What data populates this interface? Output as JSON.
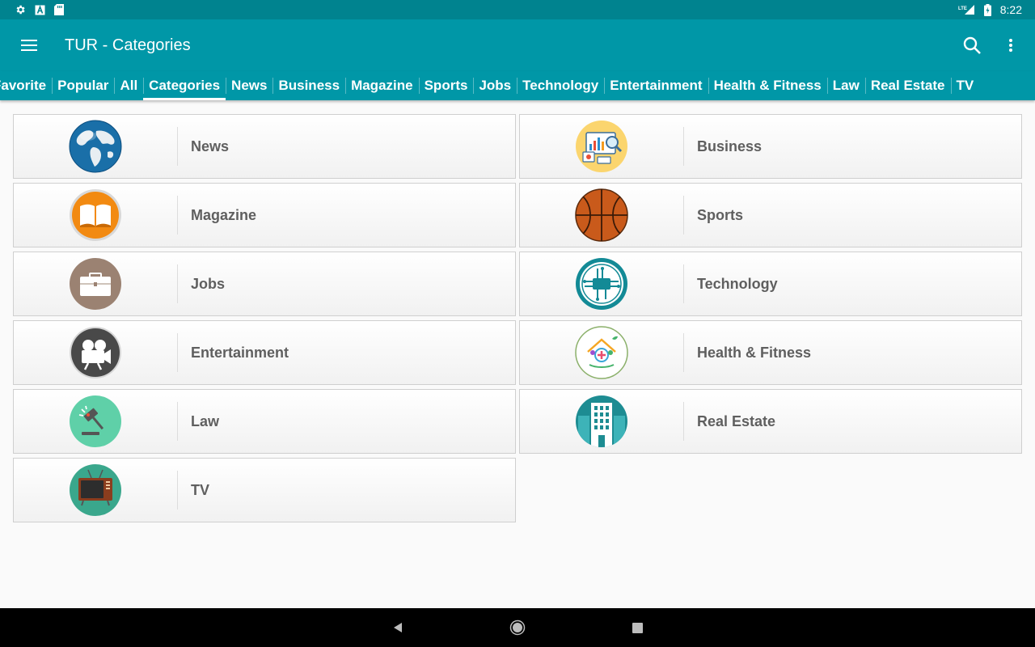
{
  "status_bar": {
    "time": "8:22",
    "network": "LTE"
  },
  "app_bar": {
    "title": "TUR - Categories"
  },
  "tabs": [
    {
      "label": "Favorite"
    },
    {
      "label": "Popular"
    },
    {
      "label": "All"
    },
    {
      "label": "Categories",
      "active": true
    },
    {
      "label": "News"
    },
    {
      "label": "Business"
    },
    {
      "label": "Magazine"
    },
    {
      "label": "Sports"
    },
    {
      "label": "Jobs"
    },
    {
      "label": "Technology"
    },
    {
      "label": "Entertainment"
    },
    {
      "label": "Health & Fitness"
    },
    {
      "label": "Law"
    },
    {
      "label": "Real Estate"
    },
    {
      "label": "TV"
    }
  ],
  "categories": [
    {
      "label": "News",
      "icon": "globe-icon"
    },
    {
      "label": "Business",
      "icon": "business-analytics-icon"
    },
    {
      "label": "Magazine",
      "icon": "book-icon"
    },
    {
      "label": "Sports",
      "icon": "basketball-icon"
    },
    {
      "label": "Jobs",
      "icon": "briefcase-icon"
    },
    {
      "label": "Technology",
      "icon": "circuit-board-icon"
    },
    {
      "label": "Entertainment",
      "icon": "movie-camera-icon"
    },
    {
      "label": "Health & Fitness",
      "icon": "health-house-icon"
    },
    {
      "label": "Law",
      "icon": "gavel-icon"
    },
    {
      "label": "Real Estate",
      "icon": "building-icon"
    },
    {
      "label": "TV",
      "icon": "television-icon"
    }
  ],
  "colors": {
    "primary": "#0097a7",
    "primary_dark": "#00838f",
    "label_text": "#5f5f5f"
  }
}
